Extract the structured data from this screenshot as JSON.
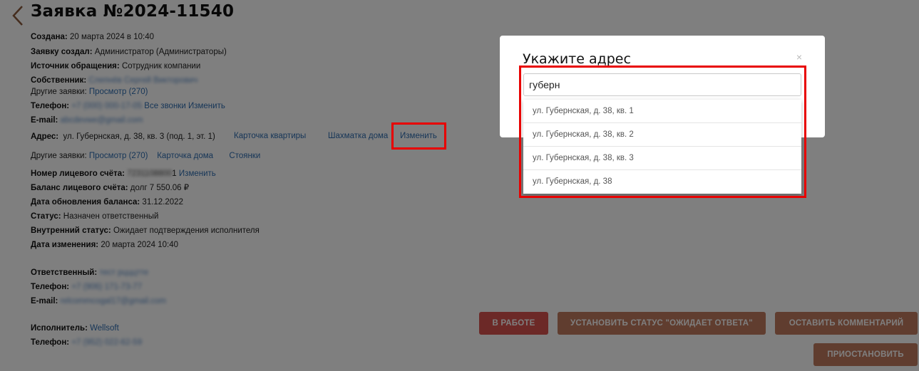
{
  "title": "Заявка №2024-11540",
  "details": {
    "created_label": "Создана:",
    "created_value": "20 марта 2024 в 10:40",
    "creator_label": "Заявку создал:",
    "creator_value": "Администратор (Администраторы)",
    "source_label": "Источник обращения:",
    "source_value": "Сотрудник компании",
    "owner_label": "Собственник:",
    "owner_value": "Слепнёв Сергей Викторович",
    "other1_label": "Другие заявки:",
    "other1_link": "Просмотр (270)",
    "phone_label": "Телефон:",
    "phone_value": "+7 (000) 000-17-05",
    "calls_link": "Все звонки",
    "change_link": "Изменить",
    "email_label": "E-mail:",
    "email_value": "abcdevwe@gmail.com",
    "address_label": "Адрес:",
    "address_value": "ул. Губернская, д. 38, кв. 3 (под. 1, эт. 1)",
    "card_flat_link": "Карточка квартиры",
    "chess_link": "Шахматка дома",
    "address_change_link": "Изменить",
    "other2_label": "Другие заявки:",
    "other2_link": "Просмотр (270)",
    "card_house_link": "Карточка дома",
    "parking_link": "Стоянки",
    "account_label": "Номер лицевого счёта:",
    "account_value": "7231108800",
    "account_tail": "1",
    "account_change": "Изменить",
    "balance_label": "Баланс лицевого счёта:",
    "balance_value": "долг 7 550.06 ₽",
    "balance_date_label": "Дата обновления баланса:",
    "balance_date_value": "31.12.2022",
    "status_label": "Статус:",
    "status_value": "Назначен ответственный",
    "inner_status_label": "Внутренний статус:",
    "inner_status_value": "Ожидает подтверждения исполнителя",
    "changed_label": "Дата изменения:",
    "changed_value": "20 марта 2024 10:40",
    "resp_label": "Ответственный:",
    "resp_value": "тест рцццтте",
    "resp_phone_label": "Телефон:",
    "resp_phone_value": "+7 (906) 171-73-77",
    "resp_email_label": "E-mail:",
    "resp_email_value": "relcommcogal17@gmail.com",
    "exec_label": "Исполнитель:",
    "exec_value": "Wellsoft",
    "exec_phone_label": "Телефон:",
    "exec_phone_value": "+7 (952) 022-62-59"
  },
  "buttons": {
    "in_work": "В РАБОТЕ",
    "set_status": "УСТАНОВИТЬ СТАТУС \"ОЖИДАЕТ ОТВЕТА\"",
    "comment": "ОСТАВИТЬ КОММЕНТАРИЙ",
    "pause": "ПРИОСТАНОВИТЬ"
  },
  "modal": {
    "title": "Укажите адрес",
    "close": "×",
    "input_value": "губерн",
    "suggestions": [
      "ул. Губернская, д. 38, кв. 1",
      "ул. Губернская, д. 38, кв. 2",
      "ул. Губернская, д. 38, кв. 3",
      "ул. Губернская, д. 38"
    ]
  },
  "colors": {
    "link": "#2f6db0",
    "btn_red": "#d9534f",
    "btn_brown": "#c07a5e",
    "highlight": "#e80000"
  },
  "icons": {
    "back": "chevron-left-icon",
    "close": "close-icon"
  }
}
